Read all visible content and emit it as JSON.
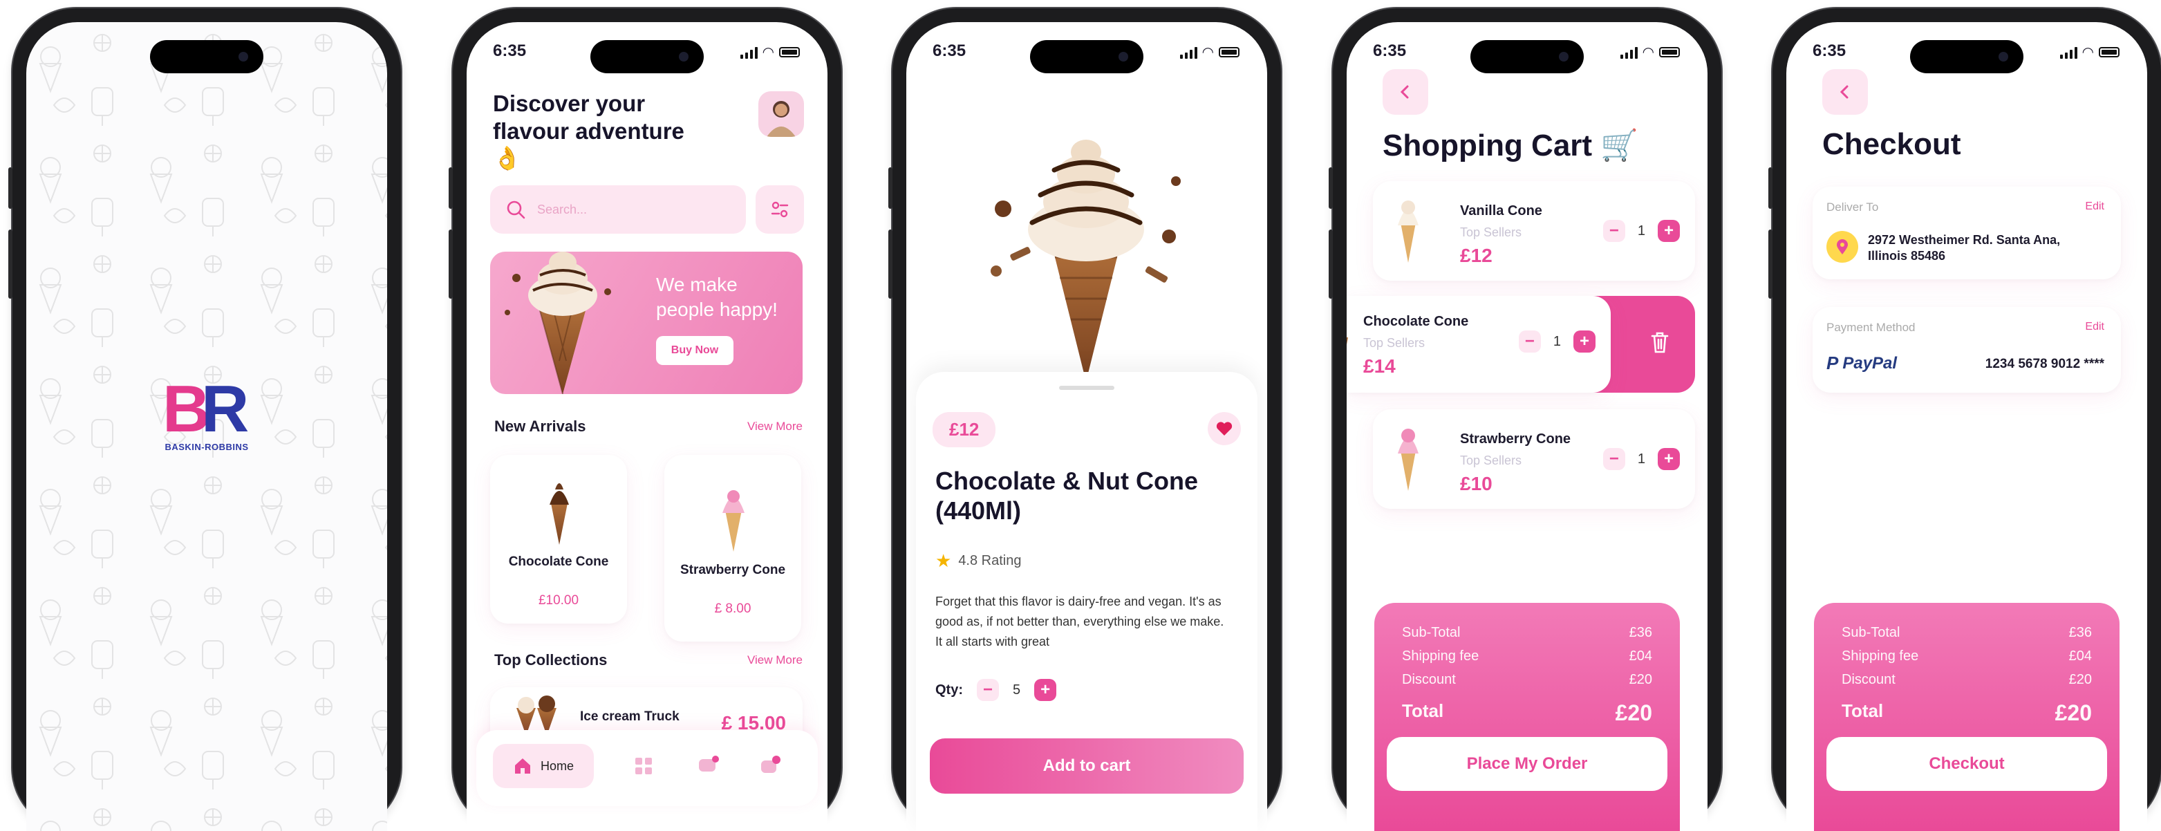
{
  "colors": {
    "accent": "#e94a98",
    "accent_light": "#fde6f1",
    "brand_blue": "#2e3aa6",
    "brand_pink": "#e43a8d"
  },
  "splash": {
    "brand_name": "BASKIN-ROBBINS",
    "brand_mark": "BR"
  },
  "home": {
    "status_time": "6:35",
    "greeting": "Discover your flavour adventure",
    "greeting_emoji": "👌",
    "search_placeholder": "Search...",
    "banner": {
      "headline": "We make people happy!",
      "button": "Buy Now"
    },
    "new_arrivals": {
      "title": "New Arrivals",
      "link": "View More",
      "items": [
        {
          "name": "Chocolate Cone",
          "price": "£10.00"
        },
        {
          "name": "Strawberry Cone",
          "price": "£ 8.00"
        }
      ]
    },
    "top_collections": {
      "title": "Top Collections",
      "link": "View More",
      "items": [
        {
          "name": "Ice cream Truck",
          "price": "£ 15.00"
        }
      ]
    },
    "nav": {
      "home": "Home"
    }
  },
  "product": {
    "status_time": "6:35",
    "price": "£12",
    "name": "Chocolate & Nut Cone (440Ml)",
    "rating": "4.8 Rating",
    "description": "Forget that this flavor is dairy-free and vegan. It's as good as, if not better than, everything else we make. It all starts with great",
    "qty_label": "Qty:",
    "qty": "5",
    "add_to_cart": "Add to cart"
  },
  "cart": {
    "status_time": "6:35",
    "title": "Shopping Cart",
    "title_emoji": "🛒",
    "items": [
      {
        "name": "Vanilla Cone",
        "tag": "Top Sellers",
        "price": "£12",
        "qty": "1"
      },
      {
        "name": "Chocolate Cone",
        "tag": "Top Sellers",
        "price": "£14",
        "qty": "1"
      },
      {
        "name": "Strawberry Cone",
        "tag": "Top Sellers",
        "price": "£10",
        "qty": "1"
      }
    ],
    "summary": {
      "subtotal_label": "Sub-Total",
      "subtotal": "£36",
      "shipping_label": "Shipping fee",
      "shipping": "£04",
      "discount_label": "Discount",
      "discount": "£20",
      "total_label": "Total",
      "total": "£20"
    },
    "cta": "Place My Order"
  },
  "checkout": {
    "status_time": "6:35",
    "title": "Checkout",
    "deliver_label": "Deliver To",
    "edit": "Edit",
    "address": "2972 Westheimer Rd. Santa Ana, Illinois 85486",
    "payment_label": "Payment Method",
    "payment_brand": "PayPal",
    "card_number": "1234 5678 9012 ****",
    "summary": {
      "subtotal_label": "Sub-Total",
      "subtotal": "£36",
      "shipping_label": "Shipping fee",
      "shipping": "£04",
      "discount_label": "Discount",
      "discount": "£20",
      "total_label": "Total",
      "total": "£20"
    },
    "cta": "Checkout"
  }
}
